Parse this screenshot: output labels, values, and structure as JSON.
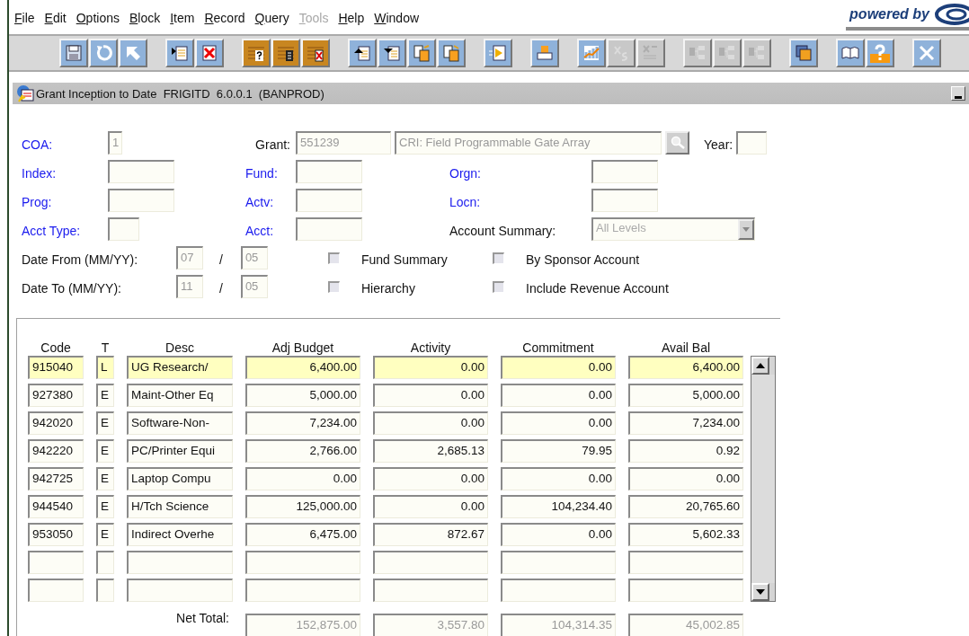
{
  "menu": [
    {
      "label": "File",
      "disabled": false
    },
    {
      "label": "Edit",
      "disabled": false
    },
    {
      "label": "Options",
      "disabled": false
    },
    {
      "label": "Block",
      "disabled": false
    },
    {
      "label": "Item",
      "disabled": false
    },
    {
      "label": "Record",
      "disabled": false
    },
    {
      "label": "Query",
      "disabled": false
    },
    {
      "label": "Tools",
      "disabled": true
    },
    {
      "label": "Help",
      "disabled": false
    },
    {
      "label": "Window",
      "disabled": false
    }
  ],
  "logo": {
    "text": "powered by"
  },
  "toolbar": [
    [
      {
        "kind": "save",
        "disabled": false
      },
      {
        "kind": "rollback",
        "disabled": false
      },
      {
        "kind": "select",
        "disabled": false
      }
    ],
    [
      {
        "kind": "insert",
        "disabled": false
      },
      {
        "kind": "remove",
        "disabled": false
      }
    ],
    [
      {
        "kind": "query",
        "disabled": false
      },
      {
        "kind": "count",
        "disabled": false
      },
      {
        "kind": "cancel",
        "disabled": false
      }
    ],
    [
      {
        "kind": "prevblock",
        "disabled": false
      },
      {
        "kind": "nextblock",
        "disabled": false
      },
      {
        "kind": "prevrec",
        "disabled": false
      },
      {
        "kind": "nextrec",
        "disabled": false
      }
    ],
    [
      {
        "kind": "play",
        "disabled": false
      }
    ],
    [
      {
        "kind": "print",
        "disabled": false
      }
    ],
    [
      {
        "kind": "chart",
        "disabled": false
      },
      {
        "kind": "xs",
        "disabled": true
      },
      {
        "kind": "xslist",
        "disabled": true
      }
    ],
    [
      {
        "kind": "node",
        "disabled": true
      },
      {
        "kind": "node",
        "disabled": true
      },
      {
        "kind": "node",
        "disabled": true
      }
    ],
    [
      {
        "kind": "f1",
        "disabled": false
      }
    ],
    [
      {
        "kind": "book",
        "disabled": false
      },
      {
        "kind": "help",
        "disabled": false
      }
    ],
    [
      {
        "kind": "close",
        "disabled": false
      }
    ]
  ],
  "window": {
    "title": "Grant Inception to Date  FRIGITD  6.0.0.1  (BANPROD)"
  },
  "key_block": {
    "coa": {
      "label": "COA:",
      "value": "1",
      "lookup": true
    },
    "grant": {
      "label": "Grant:",
      "value": "551239",
      "description": "CRI: Field Programmable Gate Array",
      "lookup": false
    },
    "year": {
      "label": "Year:",
      "lookup": false
    },
    "index": {
      "label": "Index:",
      "lookup": true
    },
    "fund": {
      "label": "Fund:",
      "lookup": true
    },
    "orgn": {
      "label": "Orgn:",
      "lookup": true
    },
    "prog": {
      "label": "Prog:",
      "lookup": true
    },
    "actv": {
      "label": "Actv:",
      "lookup": true
    },
    "locn": {
      "label": "Locn:",
      "lookup": true
    },
    "acct_type": {
      "label": "Acct Type:",
      "lookup": true
    },
    "acct": {
      "label": "Acct:",
      "lookup": true
    },
    "account_summary": {
      "label": "Account Summary:",
      "value": "All Levels"
    },
    "date_from": {
      "label": "Date From (MM/YY):",
      "month": "07",
      "separator": "/",
      "year": "05"
    },
    "date_to": {
      "label": "Date To (MM/YY):",
      "month": "11",
      "separator": "/",
      "year": "05"
    },
    "options": [
      {
        "label": "Fund Summary",
        "checked": false
      },
      {
        "label": "By Sponsor Account",
        "checked": false
      },
      {
        "label": "Hierarchy",
        "checked": false
      },
      {
        "label": "Include Revenue Account",
        "checked": false
      }
    ]
  },
  "table": {
    "columns": [
      "Code",
      "T",
      "Desc",
      "Adj Budget",
      "Activity",
      "Commitment",
      "Avail Bal"
    ],
    "rows": [
      {
        "cells": [
          "915040",
          "L",
          "UG Research/",
          "6,400.00",
          "0.00",
          "0.00",
          "6,400.00"
        ],
        "selected": true
      },
      {
        "cells": [
          "927380",
          "E",
          "Maint-Other Eq",
          "5,000.00",
          "0.00",
          "0.00",
          "5,000.00"
        ],
        "selected": false
      },
      {
        "cells": [
          "942020",
          "E",
          "Software-Non-",
          "7,234.00",
          "0.00",
          "0.00",
          "7,234.00"
        ],
        "selected": false
      },
      {
        "cells": [
          "942220",
          "E",
          "PC/Printer Equi",
          "2,766.00",
          "2,685.13",
          "79.95",
          "0.92"
        ],
        "selected": false
      },
      {
        "cells": [
          "942725",
          "E",
          "Laptop Compu",
          "0.00",
          "0.00",
          "0.00",
          "0.00"
        ],
        "selected": false
      },
      {
        "cells": [
          "944540",
          "E",
          "H/Tch Science",
          "125,000.00",
          "0.00",
          "104,234.40",
          "20,765.60"
        ],
        "selected": false
      },
      {
        "cells": [
          "953050",
          "E",
          "Indirect Overhe",
          "6,475.00",
          "872.67",
          "0.00",
          "5,602.33"
        ],
        "selected": false
      }
    ],
    "net_total": {
      "label": "Net Total:",
      "values": [
        "152,875.00",
        "3,557.80",
        "104,314.35",
        "45,002.85"
      ]
    }
  }
}
